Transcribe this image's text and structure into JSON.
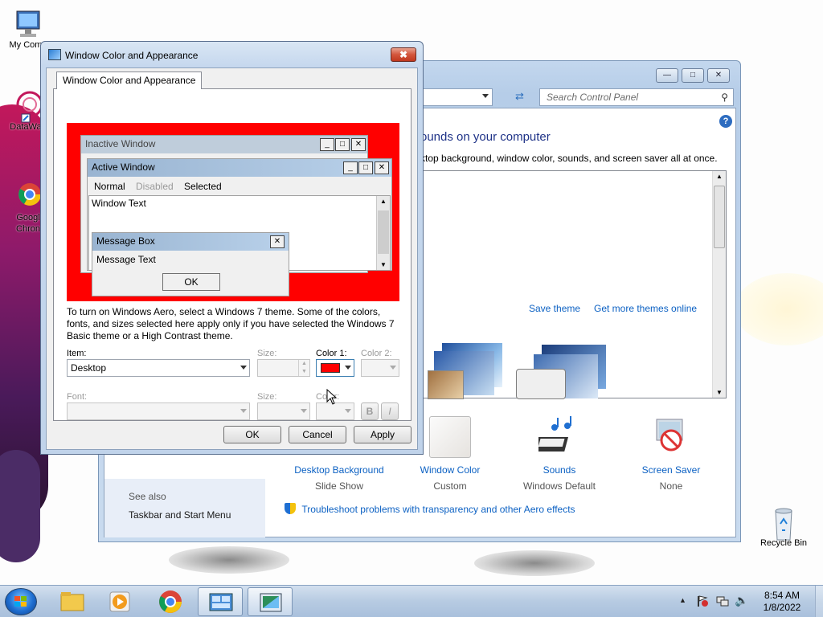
{
  "desktop": {
    "icons": [
      {
        "label": "My Comp"
      },
      {
        "label": "DataWag"
      },
      {
        "label": "Googl\nChron"
      },
      {
        "label": "Recycle Bin"
      }
    ]
  },
  "control_panel": {
    "search_placeholder": "Search Control Panel",
    "heading": "ounds on your computer",
    "subtitle": "ktop background, window color, sounds, and screen saver all at once.",
    "save_theme": "Save theme",
    "get_more_themes": "Get more themes online",
    "bottom_items": [
      {
        "title": "Desktop Background",
        "subtitle": "Slide Show"
      },
      {
        "title": "Window Color",
        "subtitle": "Custom"
      },
      {
        "title": "Sounds",
        "subtitle": "Windows Default"
      },
      {
        "title": "Screen Saver",
        "subtitle": "None"
      }
    ],
    "see_also": "See also",
    "taskbar_link": "Taskbar and Start Menu",
    "troubleshoot": "Troubleshoot problems with transparency and other Aero effects"
  },
  "dialog": {
    "title": "Window Color and Appearance",
    "tab": "Window Color and Appearance",
    "preview": {
      "inactive_title": "Inactive Window",
      "active_title": "Active Window",
      "menu_normal": "Normal",
      "menu_disabled": "Disabled",
      "menu_selected": "Selected",
      "window_text": "Window Text",
      "msgbox_title": "Message Box",
      "msgbox_text": "Message Text",
      "msgbox_ok": "OK"
    },
    "description": "To turn on Windows Aero, select a Windows 7 theme.  Some of the colors, fonts, and sizes selected here apply only if you have selected the Windows 7 Basic theme or a High Contrast theme.",
    "labels": {
      "item": "Item:",
      "size1": "Size:",
      "color1": "Color 1:",
      "color2": "Color 2:",
      "font": "Font:",
      "size2": "Size:",
      "color": "Color:"
    },
    "item_value": "Desktop",
    "color1_value": "#ff0000",
    "bold": "B",
    "italic": "I",
    "ok": "OK",
    "cancel": "Cancel",
    "apply": "Apply"
  },
  "taskbar": {
    "time": "8:54 AM",
    "date": "1/8/2022"
  }
}
